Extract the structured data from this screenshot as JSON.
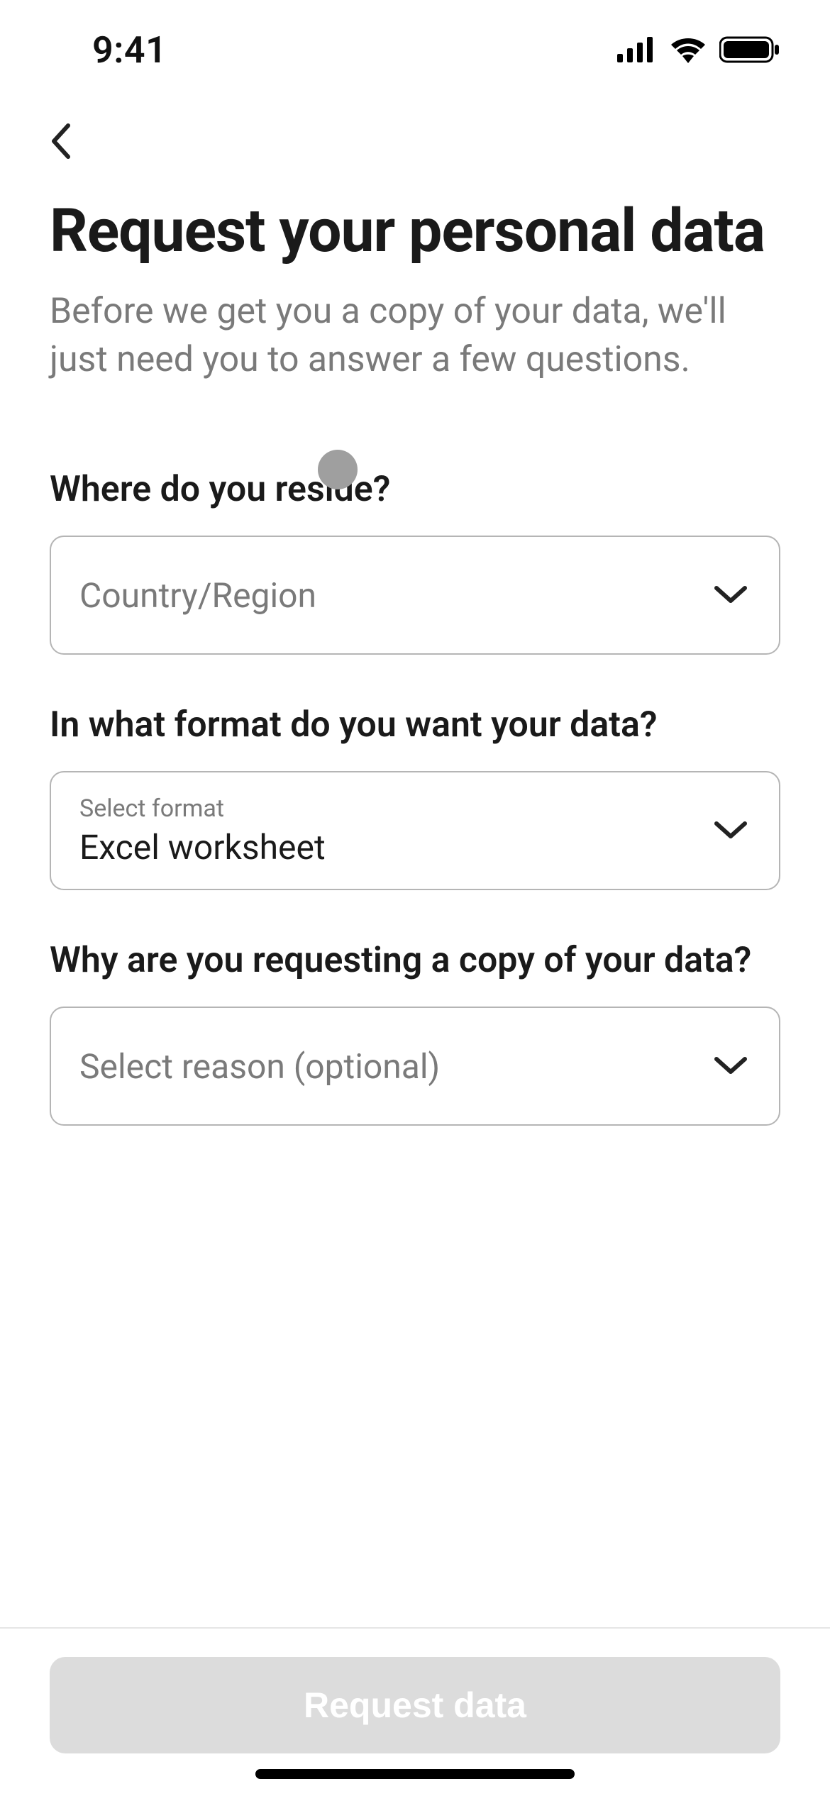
{
  "status": {
    "time": "9:41"
  },
  "page": {
    "title": "Request your personal data",
    "subtitle": "Before we get you a copy of your data, we'll just need you to answer a few questions."
  },
  "form": {
    "reside": {
      "question": "Where do you reside?",
      "placeholder": "Country/Region"
    },
    "format": {
      "question": "In what format do you want your data?",
      "floating_label": "Select format",
      "value": "Excel worksheet"
    },
    "reason": {
      "question": "Why are you requesting a copy of your data?",
      "placeholder": "Select reason (optional)"
    }
  },
  "footer": {
    "submit_label": "Request data"
  }
}
